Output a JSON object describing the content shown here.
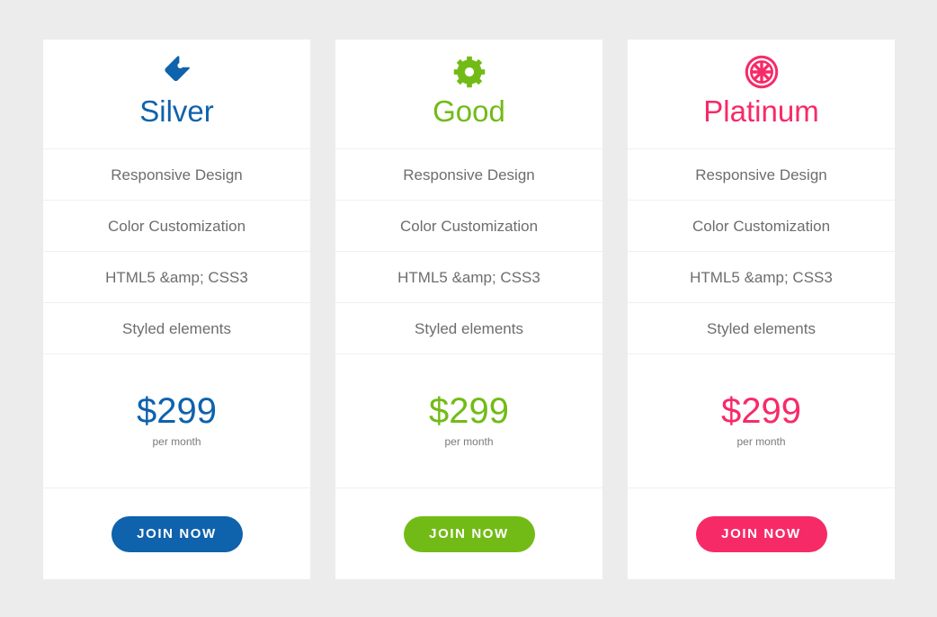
{
  "page": {
    "background_color": "#ececec",
    "card_background_color": "#ffffff",
    "divider_color": "#f0f0f0",
    "feature_text_color": "#6d6d6d",
    "period_text_color": "#7a7a7a"
  },
  "plans": [
    {
      "id": "silver",
      "title": "Silver",
      "icon": "price-tag-icon",
      "accent_color": "#0f62ac",
      "features": [
        "Responsive Design",
        "Color Customization",
        "HTML5 &amp; CSS3",
        "Styled elements"
      ],
      "price": "$299",
      "period": "per month",
      "cta_label": "JOIN NOW"
    },
    {
      "id": "good",
      "title": "Good",
      "icon": "gear-icon",
      "accent_color": "#72bb16",
      "features": [
        "Responsive Design",
        "Color Customization",
        "HTML5 &amp; CSS3",
        "Styled elements"
      ],
      "price": "$299",
      "period": "per month",
      "cta_label": "JOIN NOW"
    },
    {
      "id": "platinum",
      "title": "Platinum",
      "icon": "galactic-empire-icon",
      "accent_color": "#f72a68",
      "features": [
        "Responsive Design",
        "Color Customization",
        "HTML5 &amp; CSS3",
        "Styled elements"
      ],
      "price": "$299",
      "period": "per month",
      "cta_label": "JOIN NOW"
    }
  ]
}
